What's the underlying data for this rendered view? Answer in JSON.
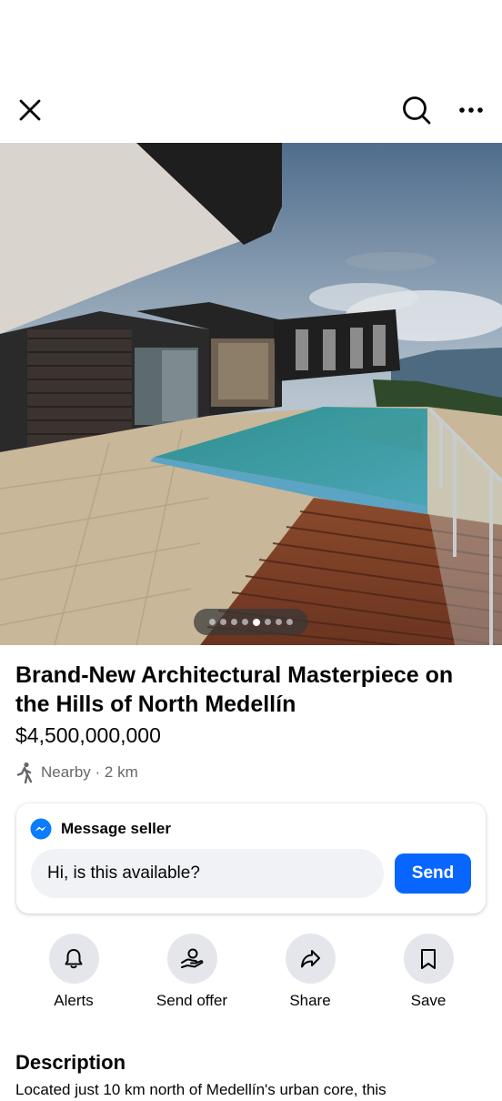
{
  "nav": {
    "icons": [
      "close-icon",
      "search-icon",
      "more-icon"
    ]
  },
  "photo": {
    "dot_count": 8,
    "active_dot": 5
  },
  "listing": {
    "title": "Brand-New Architectural Masterpiece on the Hills of North Medellín",
    "price": "$4,500,000,000",
    "distance": "Nearby · 2 km"
  },
  "message": {
    "header": "Message seller",
    "input_value": "Hi, is this available?",
    "send_label": "Send"
  },
  "actions": [
    {
      "label": "Alerts",
      "icon": "bell-icon"
    },
    {
      "label": "Send offer",
      "icon": "offer-icon"
    },
    {
      "label": "Share",
      "icon": "share-icon"
    },
    {
      "label": "Save",
      "icon": "bookmark-icon"
    }
  ],
  "description": {
    "heading": "Description",
    "text": "Located just 10 km north of Medellín's urban core, this"
  },
  "colors": {
    "accent": "#0866ff",
    "secondary_text": "#65676b",
    "action_bg": "#e4e6eb",
    "input_bg": "#f0f2f5"
  }
}
